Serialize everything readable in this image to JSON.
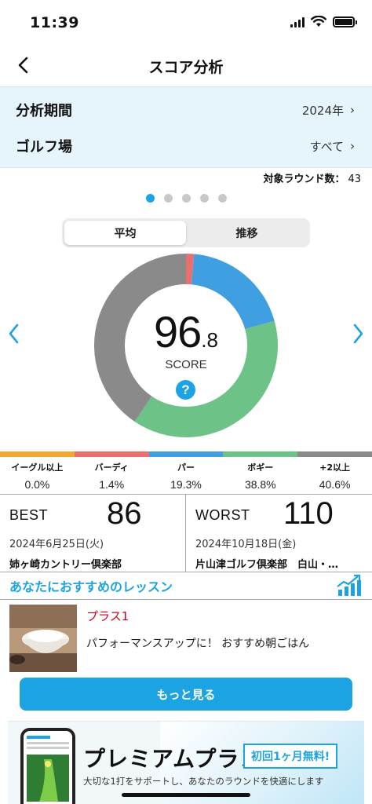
{
  "status_bar": {
    "time": "11:39"
  },
  "nav": {
    "title": "スコア分析"
  },
  "filters": {
    "period_label": "分析期間",
    "period_value": "2024年",
    "course_label": "ゴルフ場",
    "course_value": "すべて"
  },
  "round_count": {
    "label": "対象ラウンド数：",
    "value": "43"
  },
  "pager": {
    "pages": 5,
    "active_index": 0
  },
  "segments": {
    "average": "平均",
    "trend": "推移",
    "active": "average"
  },
  "score": {
    "integer": "96",
    "decimal": ".8",
    "label": "SCORE",
    "help": "?"
  },
  "chart_data": {
    "type": "pie",
    "variant": "donut",
    "categories": [
      "イーグル以上",
      "バーディ",
      "パー",
      "ボギー",
      "+2以上"
    ],
    "values": [
      0.0,
      1.4,
      19.3,
      38.8,
      40.6
    ],
    "colors": [
      "#f0a830",
      "#ec6f6f",
      "#3f9fe0",
      "#6cc287",
      "#8a8a8a"
    ]
  },
  "distribution": [
    {
      "name": "イーグル以上",
      "pct": "0.0%",
      "color": "#f0a830"
    },
    {
      "name": "バーディ",
      "pct": "1.4%",
      "color": "#ec6f6f"
    },
    {
      "name": "パー",
      "pct": "19.3%",
      "color": "#3f9fe0"
    },
    {
      "name": "ボギー",
      "pct": "38.8%",
      "color": "#6cc287"
    },
    {
      "name": "+2以上",
      "pct": "40.6%",
      "color": "#8a8a8a"
    }
  ],
  "best": {
    "label": "BEST",
    "score": "86",
    "date": "2024年6月25日(火)",
    "course": "姉ヶ崎カントリー倶楽部"
  },
  "worst": {
    "label": "WORST",
    "score": "110",
    "date": "2024年10月18日(金)",
    "course": "片山津ゴルフ倶楽部　白山・…"
  },
  "lessons": {
    "title": "あなたにおすすめのレッスン",
    "item": {
      "tag": "プラス1",
      "description": "パフォーマンスアップに！ おすすめ朝ごはん"
    },
    "more_label": "もっと見る"
  },
  "premium": {
    "title": "プレミアムプラン",
    "badge": "初回1ヶ月無料!",
    "subtitle": "大切な1打をサポートし、あなたのラウンドを快適にします"
  },
  "colors": {
    "accent": "#1ca3e3",
    "tag_red": "#d0021b",
    "filter_bg": "#e6f4fb"
  }
}
